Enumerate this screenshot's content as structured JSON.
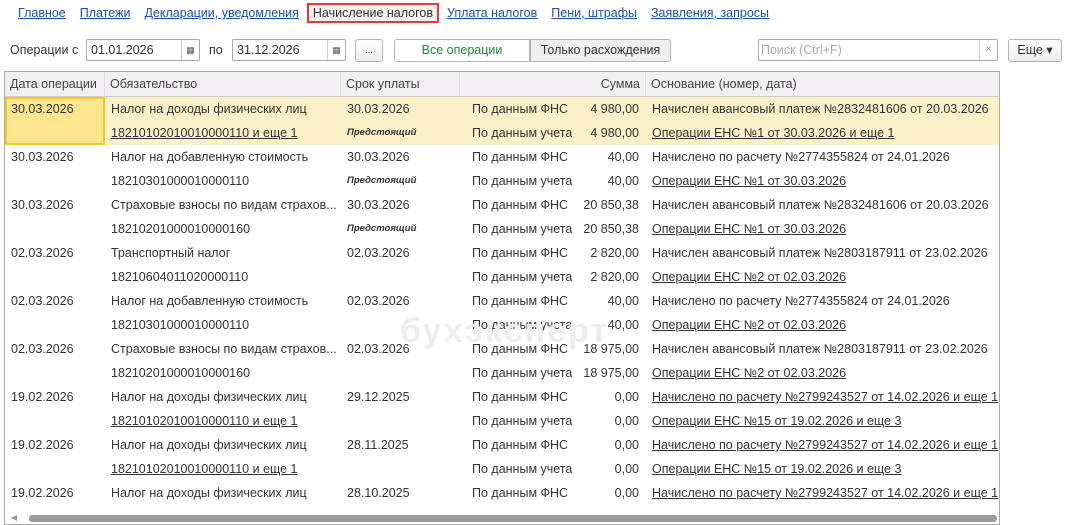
{
  "nav": [
    "Главное",
    "Платежи",
    "Декларации, уведомления",
    "Начисление налогов",
    "Уплата налогов",
    "Пени, штрафы",
    "Заявления, запросы"
  ],
  "toolbar": {
    "ops_from": "Операции с",
    "date_from": "01.01.2026",
    "to": "по",
    "date_to": "31.12.2026",
    "ellipsis": "...",
    "all_ops": "Все операции",
    "only_diff": "Только расхождения",
    "search_placeholder": "Поиск (Ctrl+F)",
    "more": "Еще ▾",
    "clear": "×",
    "cal": "▦"
  },
  "colors": {
    "accent_green": "#1e8a3a",
    "selected_row": "#fbf0c8",
    "link": "#1a4eb0",
    "active_tab_border": "#e8383d"
  },
  "headers": [
    "Дата операции",
    "Обязательство",
    "Срок уплаты",
    "Сумма",
    "Основание (номер, дата)"
  ],
  "watermark": "бухэксперт",
  "rows": [
    {
      "date": "30.03.2026",
      "name": "Налог на доходы физических лиц",
      "kbk": "18210102010010000110 и еще 1",
      "deadline": "30.03.2026",
      "status": "Предстоящий",
      "l1": "По данным ФНС",
      "a1": "4 980,00",
      "l2": "По данным учета",
      "a2": "4 980,00",
      "b1": "Начислен авансовый платеж №2832481606 от 20.03.2026",
      "b2": "Операции ЕНС №1 от 30.03.2026 и еще 1"
    },
    {
      "date": "30.03.2026",
      "name": "Налог на добавленную стоимость",
      "kbk": "18210301000010000110",
      "deadline": "30.03.2026",
      "status": "Предстоящий",
      "l1": "По данным ФНС",
      "a1": "40,00",
      "l2": "По данным учета",
      "a2": "40,00",
      "b1": "Начислено по расчету №2774355824 от 24.01.2026",
      "b2": "Операции ЕНС №1 от 30.03.2026"
    },
    {
      "date": "30.03.2026",
      "name": "Страховые взносы по видам страхов...",
      "kbk": "18210201000010000160",
      "deadline": "30.03.2026",
      "status": "Предстоящий",
      "l1": "По данным ФНС",
      "a1": "20 850,38",
      "l2": "По данным учета",
      "a2": "20 850,38",
      "b1": "Начислен авансовый платеж №2832481606 от 20.03.2026",
      "b2": "Операции ЕНС №1 от 30.03.2026"
    },
    {
      "date": "02.03.2026",
      "name": "Транспортный налог",
      "kbk": "18210604011020000110",
      "deadline": "02.03.2026",
      "status": "",
      "l1": "По данным ФНС",
      "a1": "2 820,00",
      "l2": "По данным учета",
      "a2": "2 820,00",
      "b1": "Начислен авансовый платеж №2803187911 от 23.02.2026",
      "b2": "Операции ЕНС №2 от 02.03.2026"
    },
    {
      "date": "02.03.2026",
      "name": "Налог на добавленную стоимость",
      "kbk": "18210301000010000110",
      "deadline": "02.03.2026",
      "status": "",
      "l1": "По данным ФНС",
      "a1": "40,00",
      "l2": "По данным учета",
      "a2": "40,00",
      "b1": "Начислено по расчету №2774355824 от 24.01.2026",
      "b2": "Операции ЕНС №2 от 02.03.2026"
    },
    {
      "date": "02.03.2026",
      "name": "Страховые взносы по видам страхов...",
      "kbk": "18210201000010000160",
      "deadline": "02.03.2026",
      "status": "",
      "l1": "По данным ФНС",
      "a1": "18 975,00",
      "l2": "По данным учета",
      "a2": "18 975,00",
      "b1": "Начислен авансовый платеж №2803187911 от 23.02.2026",
      "b2": "Операции ЕНС №2 от 02.03.2026"
    },
    {
      "date": "19.02.2026",
      "name": "Налог на доходы физических лиц",
      "kbk": "18210102010010000110 и еще 1",
      "deadline": "29.12.2025",
      "status": "",
      "l1": "По данным ФНС",
      "a1": "0,00",
      "l2": "По данным учета",
      "a2": "0,00",
      "b1": "Начислено по расчету №2799243527 от 14.02.2026 и еще 1",
      "b2": "Операции ЕНС №15 от 19.02.2026 и еще 3"
    },
    {
      "date": "19.02.2026",
      "name": "Налог на доходы физических лиц",
      "kbk": "18210102010010000110 и еще 1",
      "deadline": "28.11.2025",
      "status": "",
      "l1": "По данным ФНС",
      "a1": "0,00",
      "l2": "По данным учета",
      "a2": "0,00",
      "b1": "Начислено по расчету №2799243527 от 14.02.2026 и еще 1",
      "b2": "Операции ЕНС №15 от 19.02.2026 и еще 3"
    },
    {
      "date": "19.02.2026",
      "name": "Налог на доходы физических лиц",
      "kbk": "",
      "deadline": "28.10.2025",
      "status": "",
      "l1": "По данным ФНС",
      "a1": "0,00",
      "l2": "",
      "a2": "",
      "b1": "Начислено по расчету №2799243527 от 14.02.2026 и еще 1",
      "b2": ""
    }
  ]
}
